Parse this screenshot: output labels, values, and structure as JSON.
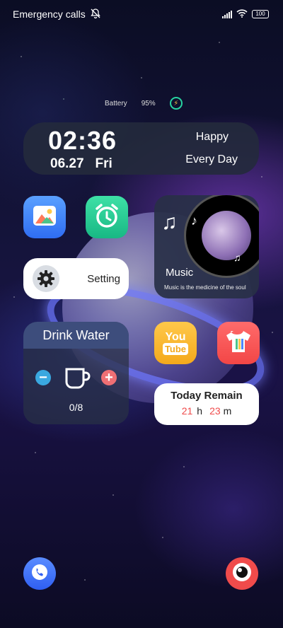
{
  "status_bar": {
    "carrier_text": "Emergency calls",
    "battery_level": "100",
    "icons": [
      "mute-icon",
      "signal-icon",
      "wifi-icon",
      "battery-icon"
    ]
  },
  "battery_line": {
    "label": "Battery",
    "percent": "95%",
    "icon": "charging-bolt-icon"
  },
  "clock_widget": {
    "time": "02:36",
    "date": "06.27",
    "weekday": "Fri",
    "greeting_line1": "Happy",
    "greeting_line2": "Every Day"
  },
  "apps": [
    {
      "name": "gallery",
      "icon": "gallery-icon"
    },
    {
      "name": "clock",
      "icon": "alarm-clock-icon"
    },
    {
      "name": "youtube",
      "icon": "youtube-icon"
    },
    {
      "name": "theme",
      "icon": "tshirt-icon"
    }
  ],
  "youtube_icon": {
    "line1": "You",
    "line2": "Tube"
  },
  "setting_widget": {
    "label": "Setting",
    "icon": "gear-icon"
  },
  "music_widget": {
    "title": "Music",
    "subtitle": "Music is the medicine of the soul",
    "note_glyph": "♫",
    "small_note_glyph": "♪"
  },
  "drink_widget": {
    "title": "Drink Water",
    "count": "0/8",
    "minus": "−",
    "plus": "+"
  },
  "remain_widget": {
    "title": "Today Remain",
    "hours": "21",
    "hours_unit": "h",
    "minutes": "23",
    "minutes_unit": "m"
  },
  "dock": {
    "phone_icon": "phone-icon",
    "camera_icon": "camera-icon"
  },
  "colors": {
    "accent_red": "#ef4b4b",
    "accent_green": "#27d3a0",
    "widget_dark": "#232a3c"
  }
}
